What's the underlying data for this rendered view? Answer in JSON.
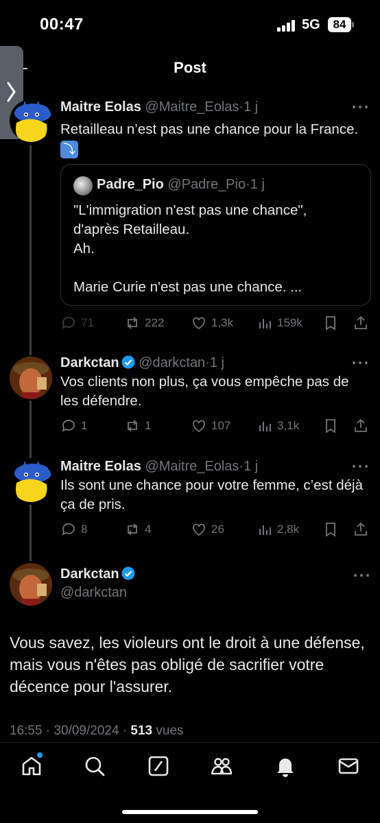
{
  "status": {
    "time": "00:47",
    "network": "5G",
    "battery": "84"
  },
  "header": {
    "title": "Post"
  },
  "posts": [
    {
      "name": "Maitre Eolas",
      "handle": "@Maitre_Eolas",
      "time": "1 j",
      "text": "Retailleau n’est pas une chance pour la France.",
      "emoji": "⤵",
      "quote": {
        "name": "Padre_Pio",
        "handle": "@Padre_Pio",
        "time": "1 j",
        "line1": "\"L'immigration n'est pas une chance\",",
        "line2": "d'après Retailleau.",
        "line3": "Ah.",
        "line4": "Marie Curie n'est pas une chance. ..."
      },
      "replies": "71",
      "reposts": "222",
      "likes": "1,3k",
      "views": "159k"
    },
    {
      "name": "Darkctan",
      "handle": "@darkctan",
      "time": "1 j",
      "text": "Vos clients non plus, ça vous empêche pas de les défendre.",
      "replies": "1",
      "reposts": "1",
      "likes": "107",
      "views": "3,1k"
    },
    {
      "name": "Maitre Eolas",
      "handle": "@Maitre_Eolas",
      "time": "1 j",
      "text": "Ils sont une chance pour votre femme, c’est déjà ça de pris.",
      "replies": "8",
      "reposts": "4",
      "likes": "26",
      "views": "2,8k"
    }
  ],
  "main": {
    "name": "Darkctan",
    "handle": "@darkctan",
    "text": "Vous savez, les violeurs ont le droit à une défense, mais vous n'êtes pas obligé de sacrifier votre décence pour l'assurer.",
    "timestamp": "16:55 · 30/09/2024 ·",
    "views_count": "513",
    "views_label": "vues"
  },
  "separator": "·",
  "colors": {
    "accent": "#1d9bf0",
    "background": "#000000",
    "muted": "#71767b"
  },
  "nav": [
    "home-icon",
    "search-icon",
    "grok-icon",
    "communities-icon",
    "notifications-icon",
    "messages-icon"
  ]
}
